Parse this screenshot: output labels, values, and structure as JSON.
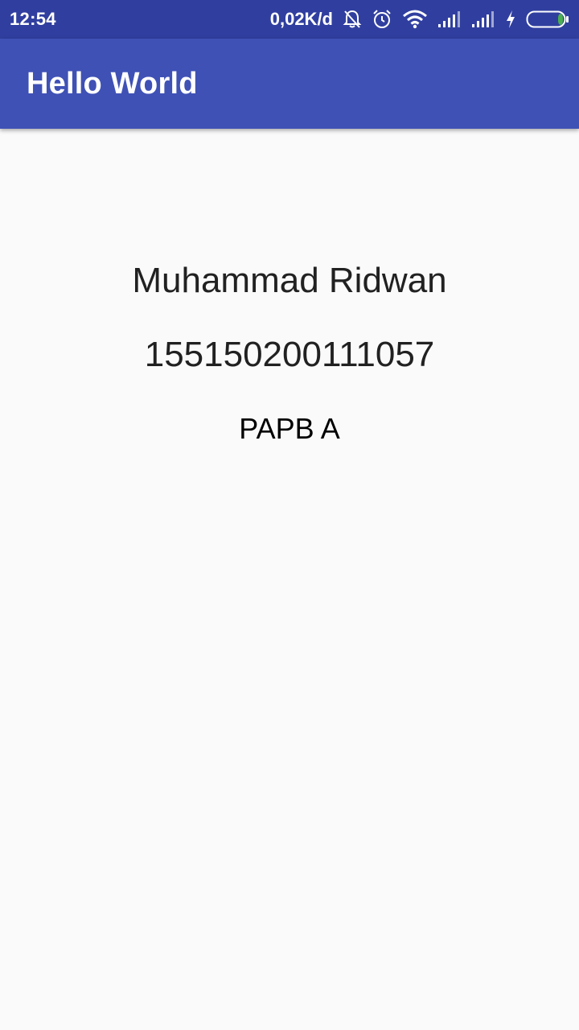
{
  "status_bar": {
    "time": "12:54",
    "network_speed": "0,02K/d",
    "icons": [
      "alarm-off-icon",
      "alarm-clock-icon",
      "wifi-icon",
      "signal-icon",
      "signal-icon",
      "charging-icon",
      "battery-icon"
    ],
    "battery_color": "#4caf50",
    "background": "#303f9f"
  },
  "app_bar": {
    "title": "Hello World",
    "background": "#3f51b5"
  },
  "main": {
    "name": "Muhammad Ridwan",
    "nim": "155150200111057",
    "class_label": "PAPB A"
  }
}
